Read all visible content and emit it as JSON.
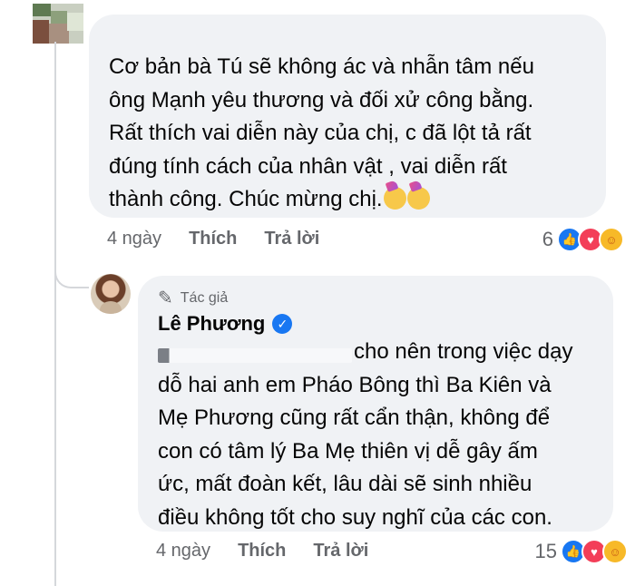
{
  "comment": {
    "text_lines": [
      "Cơ bản bà Tú sẽ không ác và nhẫn tâm nếu",
      "ông Mạnh yêu thương và đối xử công bằng.",
      "Rất thích vai diễn này của chị, c đã lột tả rất",
      "đúng tính cách của nhân vật , vai diễn rất",
      "thành công. Chúc mừng chị."
    ],
    "time": "4 ngày",
    "like_label": "Thích",
    "reply_label": "Trả lời",
    "reaction_count": "6",
    "reaction_icons": [
      "like-icon",
      "love-icon",
      "care-icon"
    ]
  },
  "reply": {
    "badge_icon": "pen-icon",
    "badge_label": "Tác giả",
    "author_name": "Lê Phương",
    "verified_icon": "verified-icon",
    "text_lines": [
      "cho nên trong việc dạy",
      "dỗ hai anh em Pháo Bông thì Ba Kiên và",
      "Mẹ Phương cũng rất cẩn thận, không để",
      "con có tâm lý Ba Mẹ thiên vị dễ gây ấm",
      "ức, mất đoàn kết, lâu dài sẽ sinh nhiều",
      "điều không tốt cho suy nghĩ của các con."
    ],
    "time": "4 ngày",
    "like_label": "Thích",
    "reply_label": "Trả lời",
    "reaction_count": "15",
    "reaction_icons": [
      "like-icon",
      "love-icon",
      "care-icon"
    ]
  },
  "colors": {
    "bubble_bg": "#f0f2f5",
    "meta_text": "#65676b",
    "like_blue": "#1877f2",
    "love_red": "#f33e58",
    "care_yellow": "#f7b928"
  }
}
